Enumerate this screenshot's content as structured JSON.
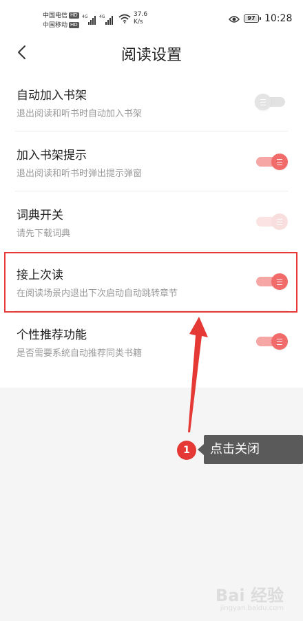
{
  "status_bar": {
    "carrier1": "中国电信",
    "carrier2": "中国移动",
    "hd": "HD",
    "network_tag": "4G",
    "speed_value": "37.6",
    "speed_unit": "K/s",
    "battery": "97",
    "time": "10:28"
  },
  "header": {
    "title": "阅读设置",
    "back_icon": "chevron-left-icon"
  },
  "settings": [
    {
      "title": "自动加入书架",
      "subtitle": "退出阅读和听书时自动加入书架",
      "state": "off"
    },
    {
      "title": "加入书架提示",
      "subtitle": "退出阅读和听书时弹出提示弹窗",
      "state": "on"
    },
    {
      "title": "词典开关",
      "subtitle": "请先下载词典",
      "state": "disabled"
    },
    {
      "title": "接上次读",
      "subtitle": "在阅读场景内退出下次启动自动跳转章节",
      "state": "on"
    },
    {
      "title": "个性推荐功能",
      "subtitle": "是否需要系统自动推荐同类书籍",
      "state": "on"
    }
  ],
  "annotation": {
    "step_number": "1",
    "tooltip": "点击关闭",
    "color": "#e53935"
  },
  "watermark": {
    "brand": "Bai 经验",
    "url": "jingyan.baidu.com"
  },
  "colors": {
    "toggle_on": "#f26b6b",
    "toggle_track_on": "#f7a6a6",
    "toggle_off": "#e4e4e4"
  }
}
